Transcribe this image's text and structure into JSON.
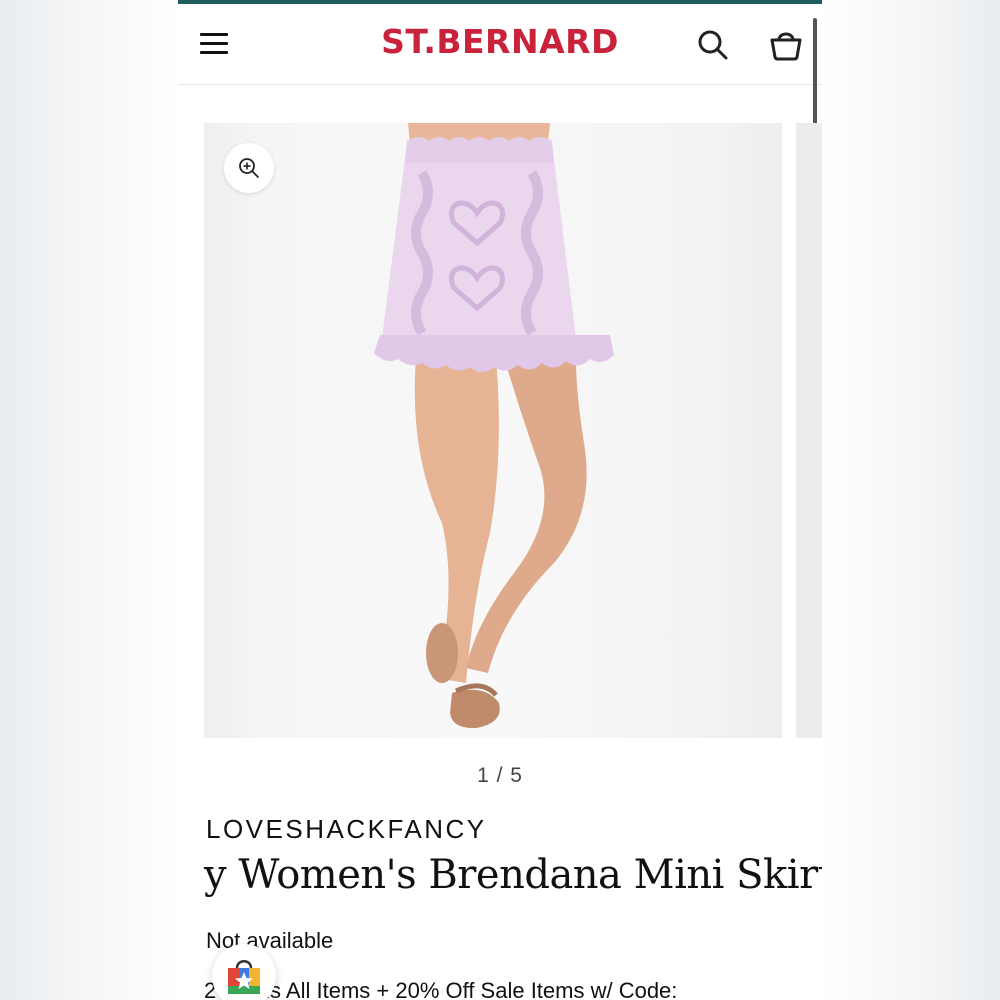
{
  "header": {
    "logo_text": "ST.BERNARD",
    "logo_color": "#c8233a",
    "accent_bar_color": "#1d5c5f",
    "menu_icon": "hamburger-menu-icon",
    "search_icon": "search-icon",
    "cart_icon": "shopping-bag-icon"
  },
  "gallery": {
    "zoom_icon": "zoom-in-icon",
    "current": "1",
    "total": "5",
    "counter_text": "1 / 5",
    "image_subject": "pink cable-knit mini skirt with hearts and ruffle hem"
  },
  "product": {
    "brand": "LOVESHACKFANCY",
    "title": "y Women's Brendana Mini Skirt",
    "availability": "Not available"
  },
  "promo": {
    "text": "2 wards All Items + 20% Off Sale Items w/ Code:"
  },
  "rewards_widget": {
    "icon": "rewards-shopping-bag-star-icon"
  }
}
